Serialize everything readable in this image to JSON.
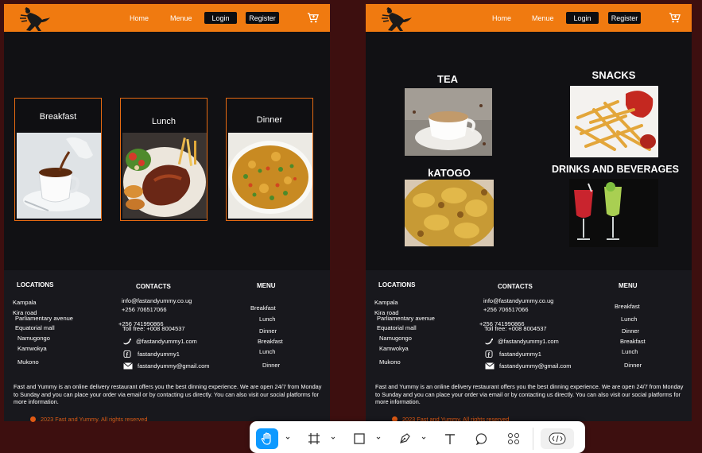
{
  "nav": {
    "home": "Home",
    "menu": "Menue",
    "login": "Login",
    "register": "Register"
  },
  "pageA": {
    "meals": [
      {
        "label": "Breakfast"
      },
      {
        "label": "Lunch"
      },
      {
        "label": "Dinner"
      }
    ]
  },
  "pageB": {
    "categories": [
      {
        "label": "TEA"
      },
      {
        "label": "SNACKS"
      },
      {
        "label": "kATOGO"
      },
      {
        "label": "DRINKS AND BEVERAGES"
      }
    ]
  },
  "footer": {
    "locations_heading": "LOCATIONS",
    "locations": [
      "Kampala",
      "Kira road",
      "Parliamentary avenue",
      "Equatorial mall",
      "Namugongo",
      "Kamwokya",
      "Mukono"
    ],
    "contacts_heading": "CONTACTS",
    "email1": "info@fastandyummy.co.ug",
    "phone1": "+256 706517066",
    "phone2": "+256 741990866",
    "tollfree": "Toll free: +008 8004537",
    "twitter": "@fastandyummy1.com",
    "facebook": "fastandyummy1",
    "gmail": "fastandyummy@gmail.com",
    "menu_heading": "MENU",
    "menu_items": [
      "Breakfast",
      "Lunch",
      "Dinner",
      "Breakfast",
      "Lunch",
      "Dinner"
    ],
    "about": "Fast and Yummy is an online delivery restaurant offers you the best dinning experience. We are open 24/7 from Monday to Sunday and you can place your order via email or by contacting us directly. You can also visit our social platforms for more information.",
    "copyright": "2023 Fast and Yummy. All rights reserved"
  },
  "toolbar": {
    "tools": [
      "hand-tool",
      "frame-tool",
      "shape-tool",
      "pen-tool",
      "text-tool",
      "comment-tool",
      "actions-tool",
      "dev-mode-toggle"
    ],
    "active": "hand-tool",
    "accent": "#0d99ff"
  },
  "colors": {
    "nav_orange": "#f07a10",
    "page_bg": "#111114",
    "footer_bg": "#18181d",
    "canvas_bg": "#3d0f0f",
    "card_border": "#e56a12"
  }
}
